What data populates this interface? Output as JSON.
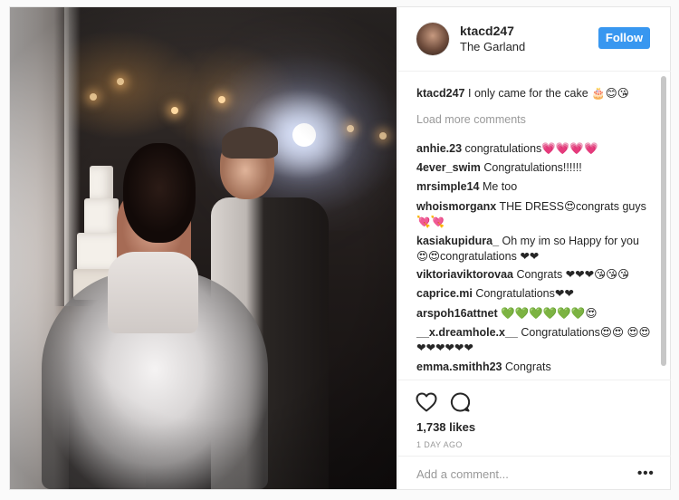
{
  "post": {
    "username": "ktacd247",
    "location": "The Garland",
    "follow_label": "Follow",
    "caption": {
      "user": "ktacd247",
      "text": "I only came for the cake 🎂😊😘"
    },
    "load_more": "Load more comments",
    "comments": [
      {
        "user": "anhie.23",
        "text": "congratulations💗💗💗💗"
      },
      {
        "user": "4ever_swim",
        "text": "Congratulations!!!!!!"
      },
      {
        "user": "mrsimple14",
        "text": "Me too"
      },
      {
        "user": "whoismorganx",
        "text": "THE DRESS😍congrats guys 💘💘"
      },
      {
        "user": "kasiakupidura_",
        "text": "Oh my im so Happy for you 😍😍congratulations ❤❤"
      },
      {
        "user": "viktoriaviktorovaa",
        "text": "Congrats ❤❤❤😘😘😘"
      },
      {
        "user": "caprice.mi",
        "text": "Congratulations❤❤"
      },
      {
        "user": "arspoh16attnet",
        "text": "💚💚💚💚💚💚😍"
      },
      {
        "user": "__x.dreamhole.x__",
        "text": "Congratulations😍😍 😍😍❤❤❤❤❤❤"
      },
      {
        "user": "emma.smithh23",
        "text": "Congrats"
      }
    ],
    "likes": "1,738 likes",
    "time": "1 DAY AGO",
    "add_comment_placeholder": "Add a comment...",
    "more_symbol": "•••",
    "icons": [
      "heart-icon",
      "comment-icon",
      "more-options-icon"
    ],
    "accent_color": "#3897f0"
  }
}
